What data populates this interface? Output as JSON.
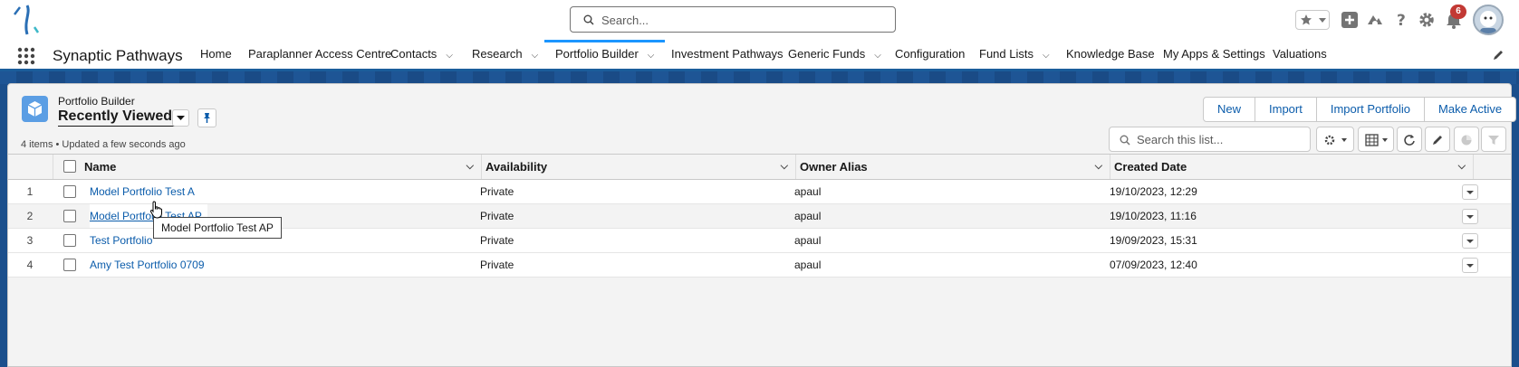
{
  "global_header": {
    "search_placeholder": "Search...",
    "notification_count": "6"
  },
  "navbar": {
    "app_name": "Synaptic Pathways",
    "items": [
      {
        "label": "Home"
      },
      {
        "label": "Paraplanner Access Centre"
      },
      {
        "label": "Contacts"
      },
      {
        "label": "Research"
      },
      {
        "label": "Portfolio Builder"
      },
      {
        "label": "Investment Pathways"
      },
      {
        "label": "Generic Funds"
      },
      {
        "label": "Configuration"
      },
      {
        "label": "Fund Lists"
      },
      {
        "label": "Knowledge Base"
      },
      {
        "label": "My Apps & Settings"
      },
      {
        "label": "Valuations"
      }
    ]
  },
  "list_view": {
    "object_label": "Portfolio Builder",
    "view_name": "Recently Viewed",
    "status": "4 items • Updated a few seconds ago",
    "buttons": {
      "new": "New",
      "import": "Import",
      "import_portfolio": "Import Portfolio",
      "make_active": "Make Active"
    },
    "search_placeholder": "Search this list..."
  },
  "table": {
    "columns": {
      "name": "Name",
      "availability": "Availability",
      "owner_alias": "Owner Alias",
      "created_date": "Created Date"
    },
    "rows": [
      {
        "num": "1",
        "name": "Model Portfolio Test A",
        "availability": "Private",
        "owner": "apaul",
        "created": "19/10/2023, 12:29"
      },
      {
        "num": "2",
        "name": "Model Portfolio Test AP",
        "availability": "Private",
        "owner": "apaul",
        "created": "19/10/2023, 11:16"
      },
      {
        "num": "3",
        "name": "Test Portfolio",
        "availability": "Private",
        "owner": "apaul",
        "created": "19/09/2023, 15:31"
      },
      {
        "num": "4",
        "name": "Amy Test Portfolio 0709",
        "availability": "Private",
        "owner": "apaul",
        "created": "07/09/2023, 12:40"
      }
    ],
    "tooltip": "Model Portfolio Test AP"
  },
  "colors": {
    "brand_blue": "#0b5cab",
    "banner": "#1b4f8c",
    "active_tab": "#1b96ff",
    "badge": "#c23934"
  }
}
